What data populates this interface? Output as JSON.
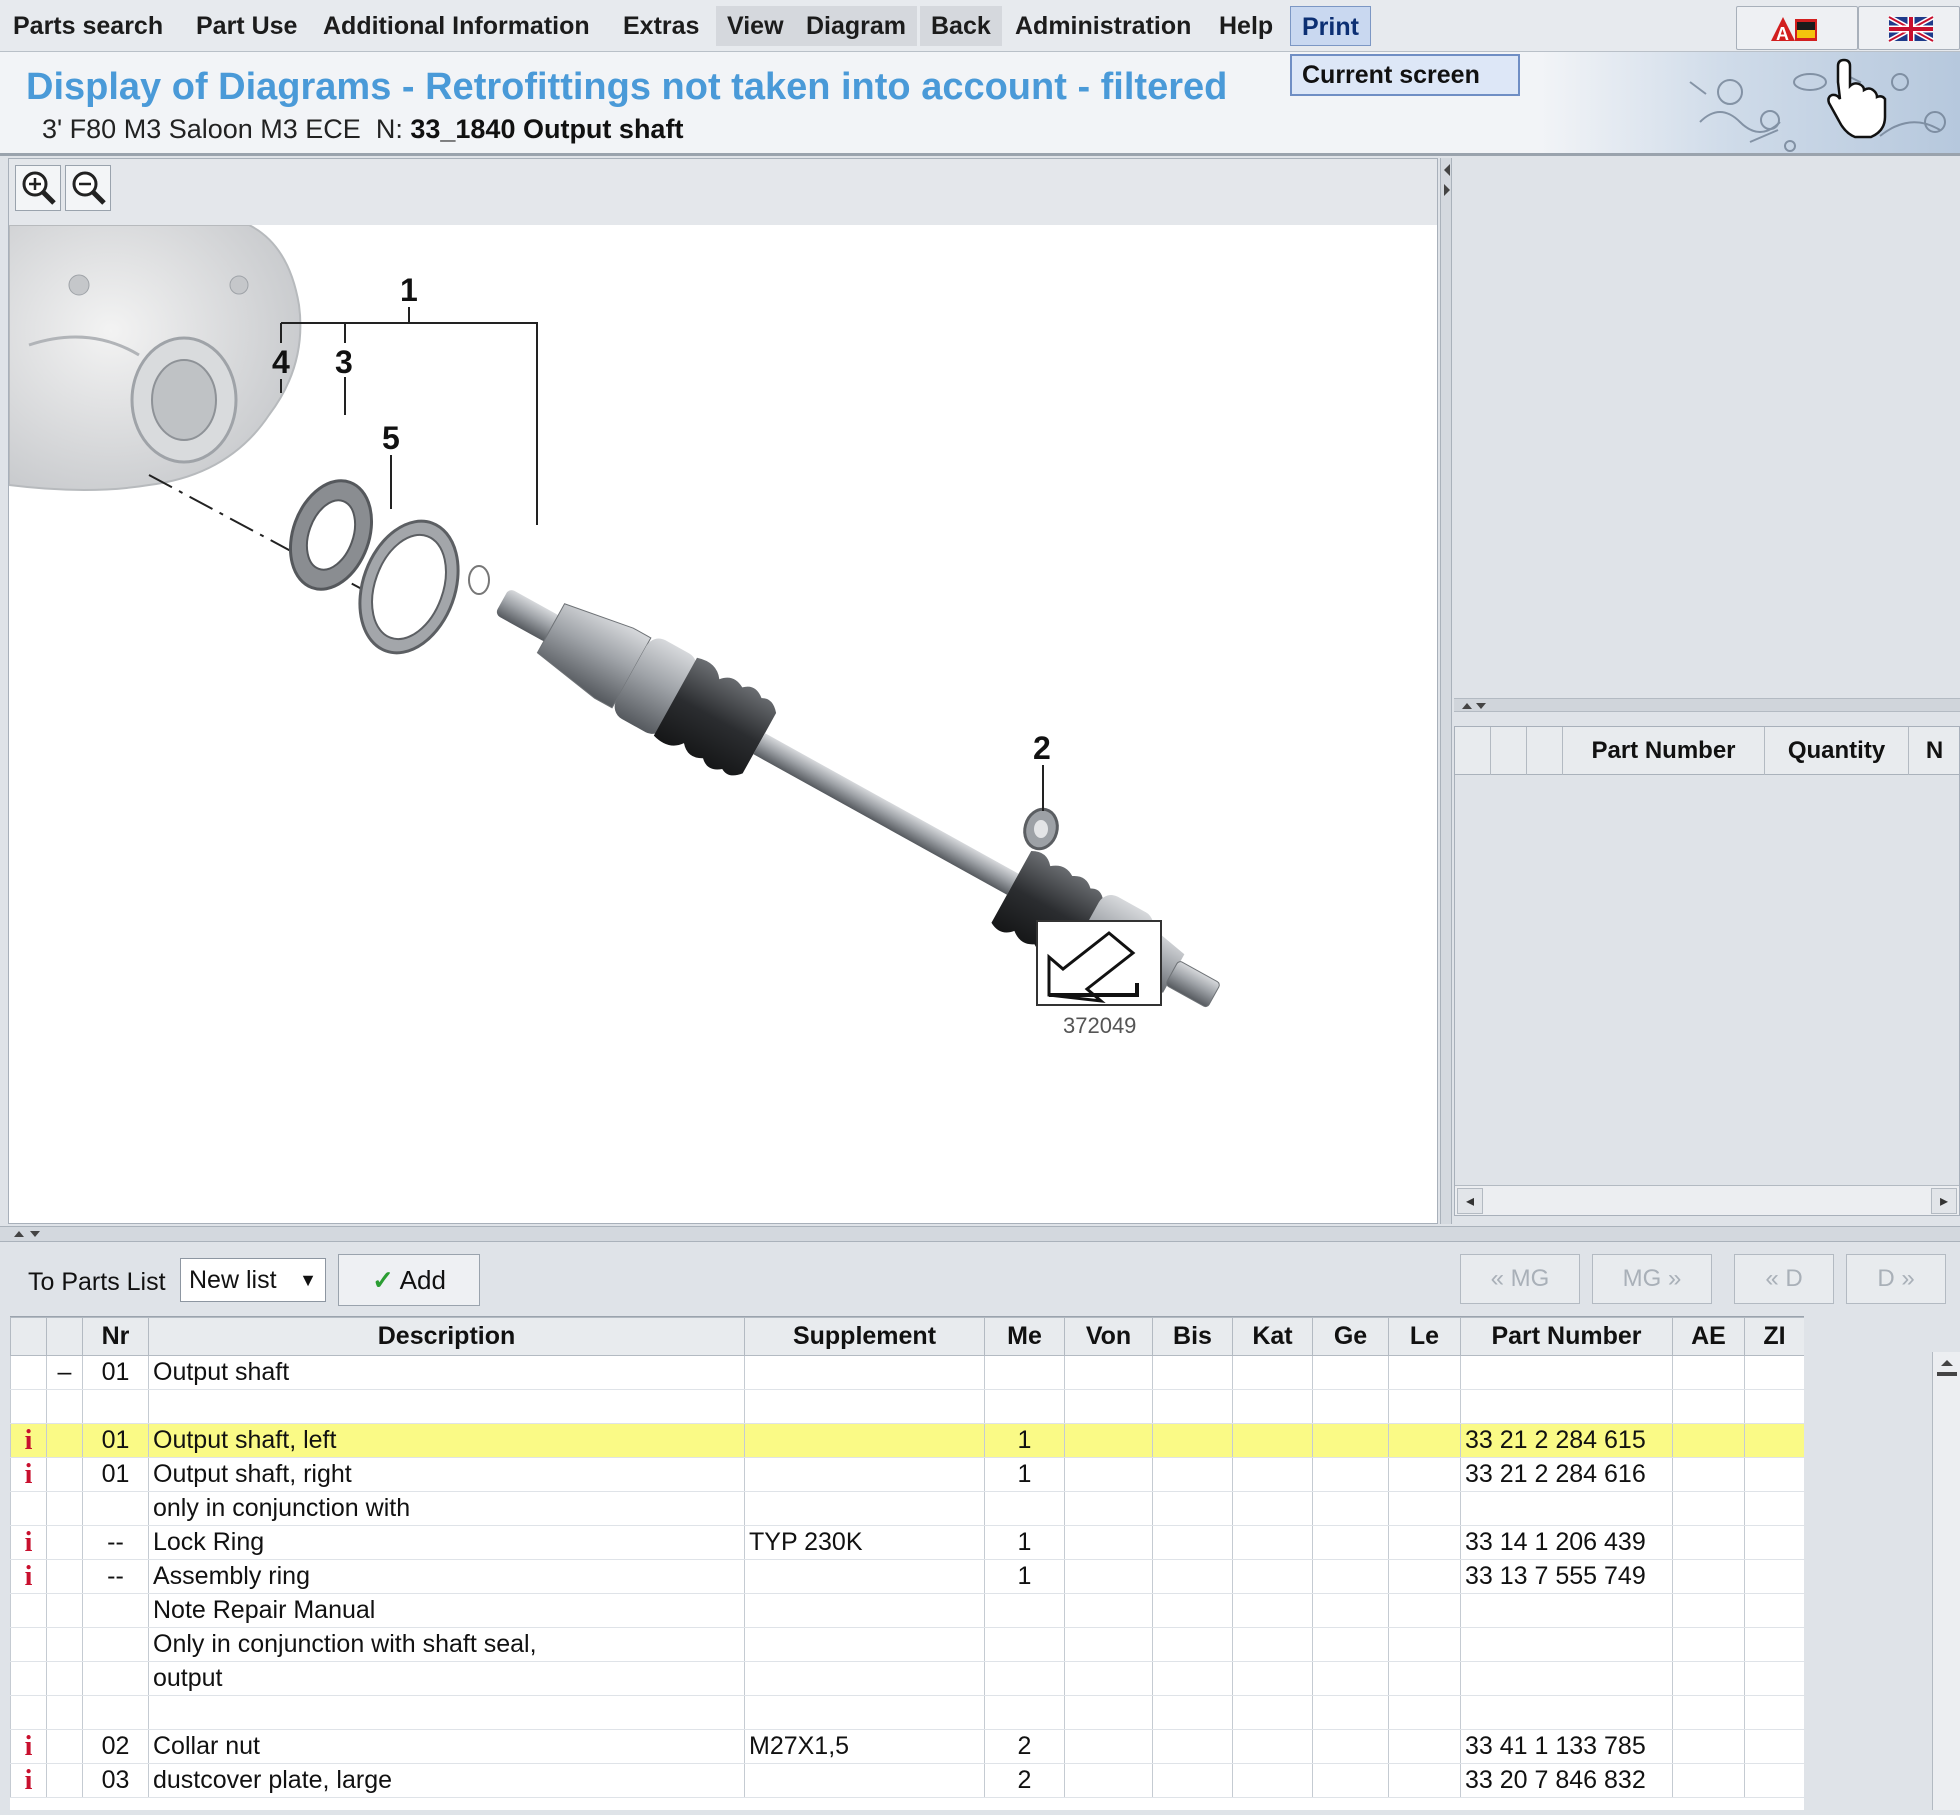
{
  "menu": {
    "items": [
      "Parts search",
      "Part Use",
      "Additional Information",
      "Extras",
      "View",
      "Diagram",
      "Back",
      "Administration",
      "Help",
      "Print"
    ],
    "print_dropdown": [
      "Current screen"
    ]
  },
  "header": {
    "title": "Display of Diagrams - Retrofittings not taken into account - filtered",
    "vehicle": "3' F80 M3 Saloon M3 ECE",
    "group_prefix": "N:",
    "group": "33_1840 Output shaft"
  },
  "diagram": {
    "callouts": [
      "1",
      "4",
      "3",
      "5",
      "2"
    ],
    "image_id": "372049",
    "icons": [
      "zoom-in-icon",
      "zoom-out-icon",
      "arrow-direction-icon"
    ]
  },
  "right_table": {
    "columns": [
      "",
      "",
      "",
      "Part Number",
      "Quantity",
      "N"
    ]
  },
  "list_toolbar": {
    "to_parts_list": "To Parts List",
    "list_select": "New list",
    "add": "Add",
    "nav": [
      "« MG",
      "MG »",
      "« D",
      "D »"
    ]
  },
  "parts_table": {
    "columns": [
      "",
      "",
      "Nr",
      "Description",
      "Supplement",
      "Me",
      "Von",
      "Bis",
      "Kat",
      "Ge",
      "Le",
      "Part Number",
      "AE",
      "ZI"
    ],
    "rows": [
      {
        "info": "",
        "expand": "–",
        "nr": "01",
        "desc": "Output shaft",
        "supp": "",
        "me": "",
        "pn": "",
        "hl": false
      },
      {
        "info": "",
        "expand": "",
        "nr": "",
        "desc": "",
        "supp": "",
        "me": "",
        "pn": "",
        "hl": false
      },
      {
        "info": "i",
        "expand": "",
        "nr": "01",
        "desc": "Output shaft, left",
        "supp": "",
        "me": "1",
        "pn": "33 21 2 284 615",
        "hl": true
      },
      {
        "info": "i",
        "expand": "",
        "nr": "01",
        "desc": "Output shaft, right",
        "supp": "",
        "me": "1",
        "pn": "33 21 2 284 616",
        "hl": false
      },
      {
        "info": "",
        "expand": "",
        "nr": "",
        "desc": "only in conjunction with",
        "supp": "",
        "me": "",
        "pn": "",
        "hl": false
      },
      {
        "info": "i",
        "expand": "",
        "nr": "--",
        "desc": "Lock Ring",
        "supp": "TYP 230K",
        "me": "1",
        "pn": "33 14 1 206 439",
        "hl": false
      },
      {
        "info": "i",
        "expand": "",
        "nr": "--",
        "desc": "Assembly ring",
        "supp": "",
        "me": "1",
        "pn": "33 13 7 555 749",
        "hl": false
      },
      {
        "info": "",
        "expand": "",
        "nr": "",
        "desc": "Note Repair Manual",
        "supp": "",
        "me": "",
        "pn": "",
        "hl": false
      },
      {
        "info": "",
        "expand": "",
        "nr": "",
        "desc": "Only in conjunction with shaft seal,",
        "supp": "",
        "me": "",
        "pn": "",
        "hl": false
      },
      {
        "info": "",
        "expand": "",
        "nr": "",
        "desc": "output",
        "supp": "",
        "me": "",
        "pn": "",
        "hl": false
      },
      {
        "info": "",
        "expand": "",
        "nr": "",
        "desc": "",
        "supp": "",
        "me": "",
        "pn": "",
        "hl": false
      },
      {
        "info": "i",
        "expand": "",
        "nr": "02",
        "desc": "Collar nut",
        "supp": "M27X1,5",
        "me": "2",
        "pn": "33 41 1 133 785",
        "hl": false
      },
      {
        "info": "i",
        "expand": "",
        "nr": "03",
        "desc": "dustcover plate, large",
        "supp": "",
        "me": "2",
        "pn": "33 20 7 846 832",
        "hl": false
      }
    ]
  },
  "colors": {
    "title": "#4a9ad8",
    "highlight_row": "#fafa86",
    "info_icon": "#c8102e"
  }
}
